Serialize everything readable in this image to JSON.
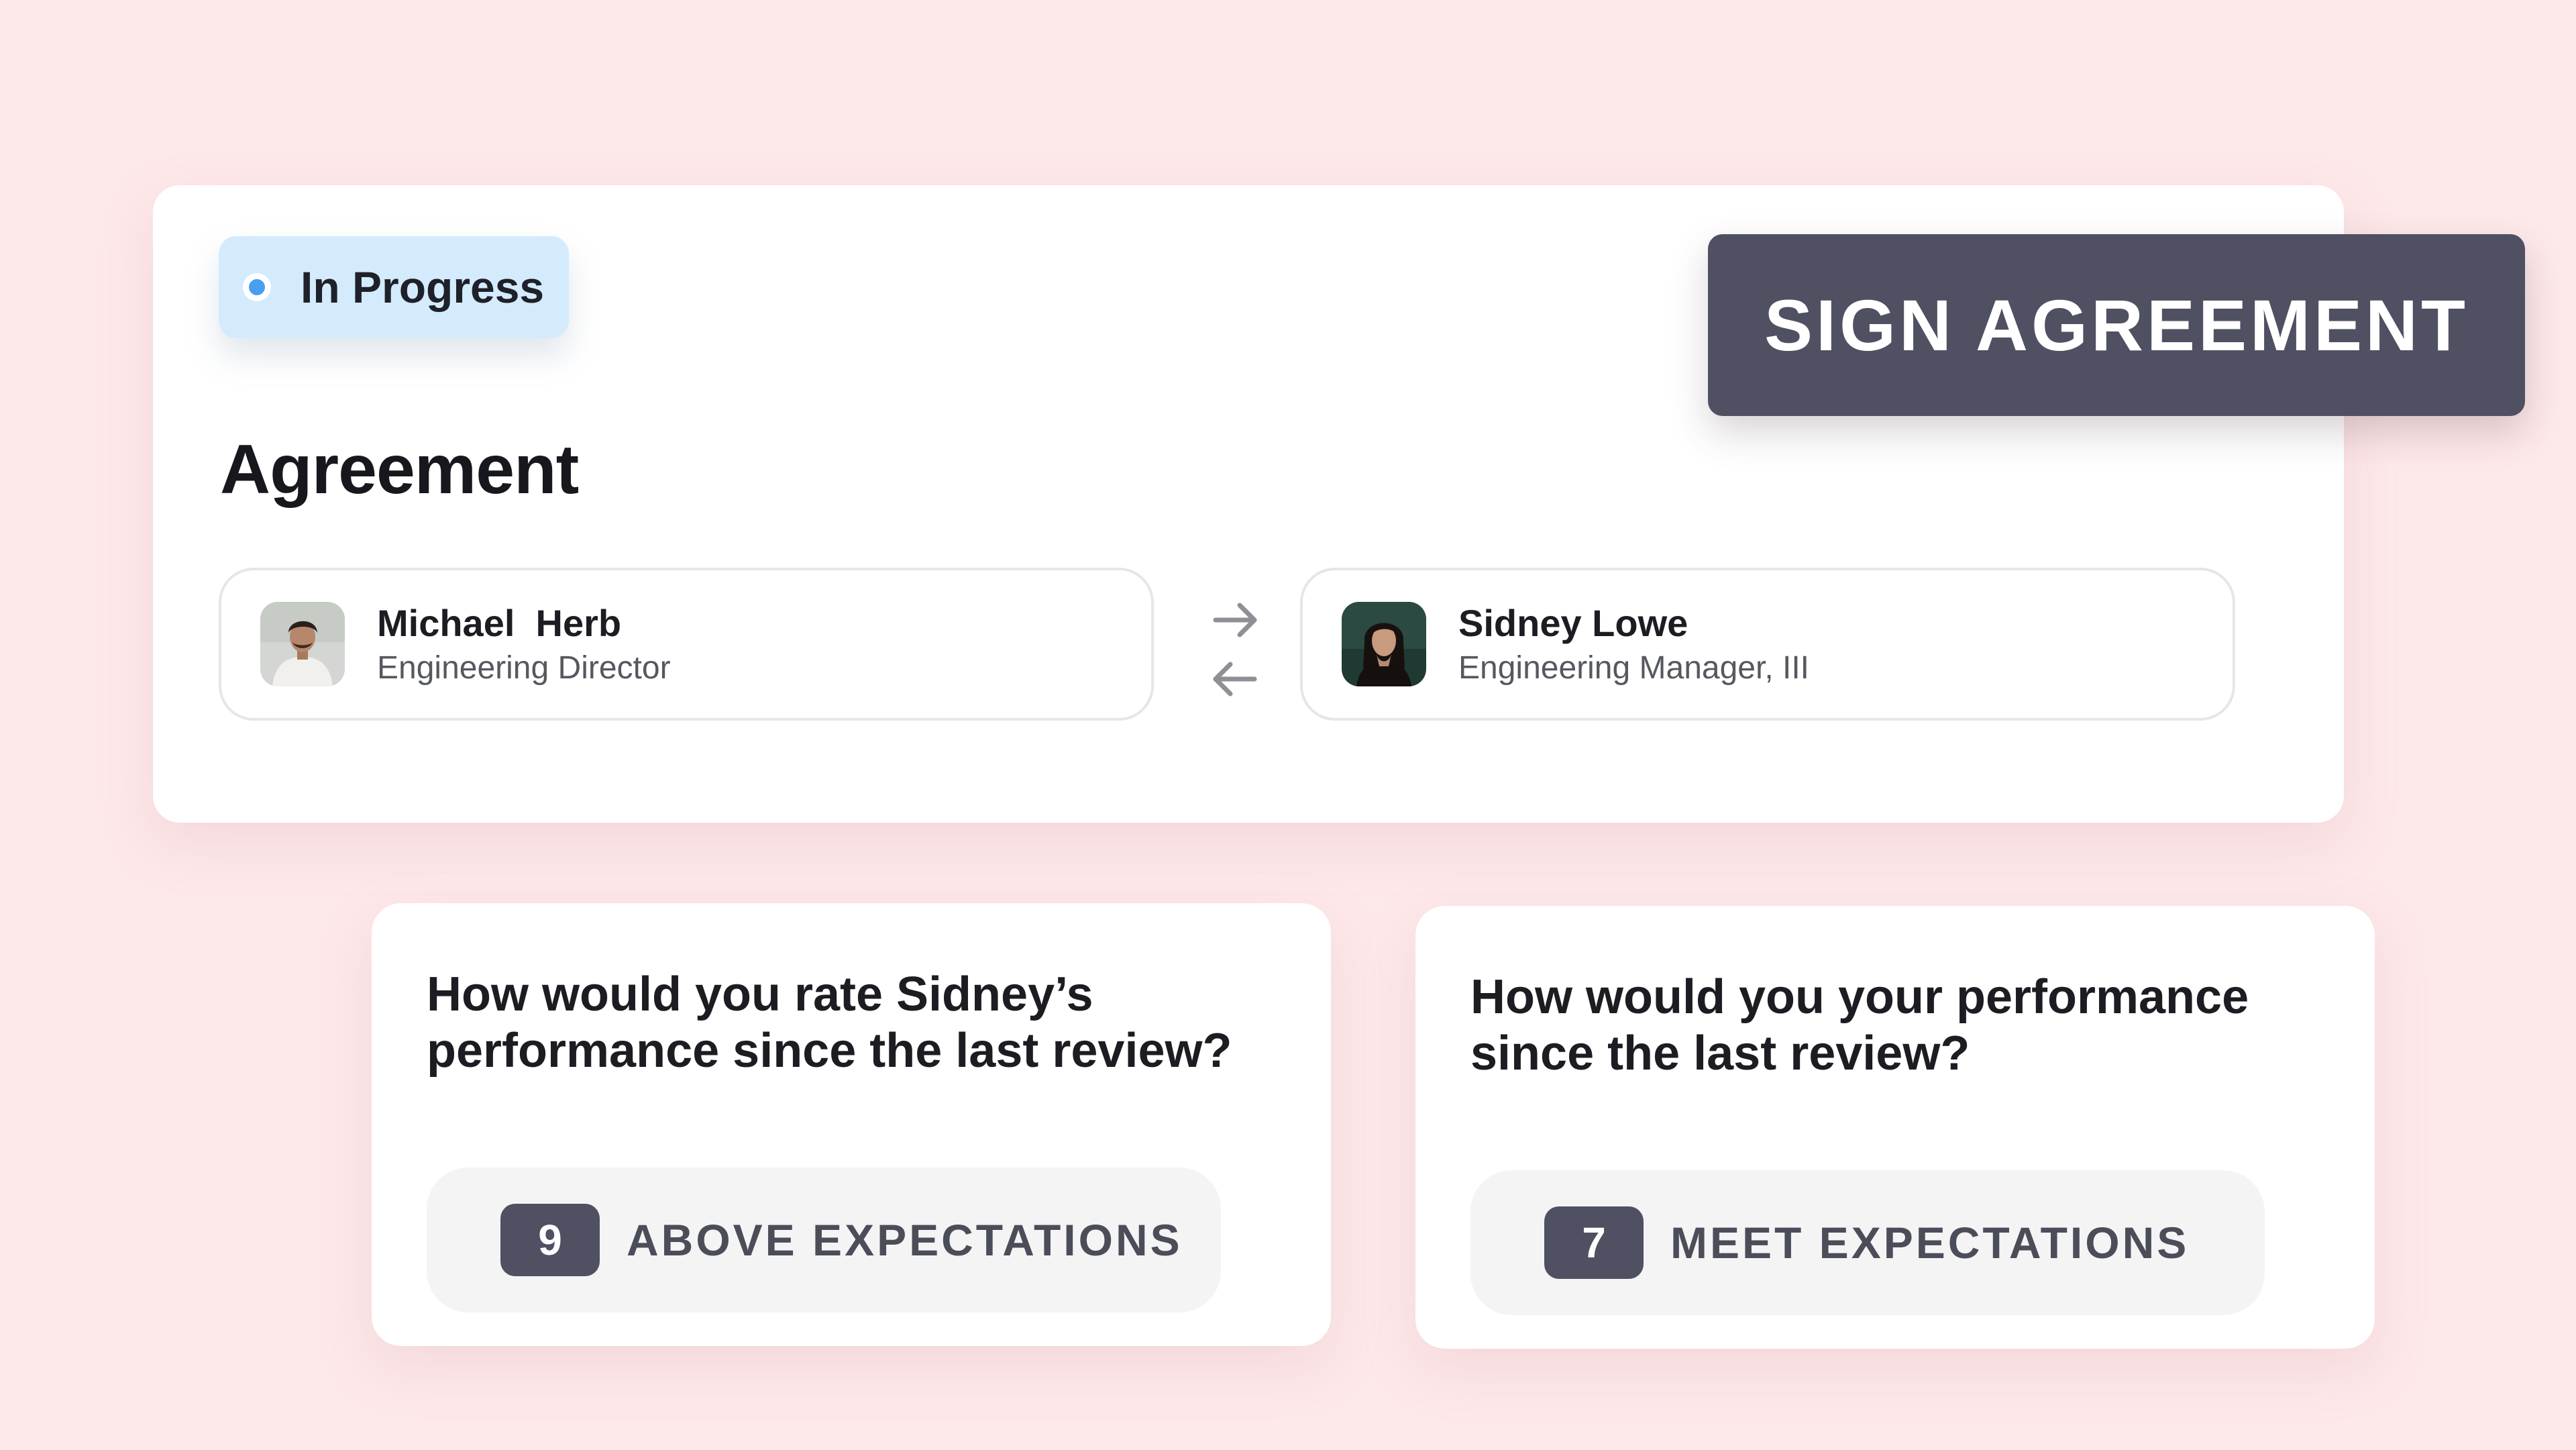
{
  "status": {
    "label": "In Progress",
    "dot_color": "#4a9eef",
    "pill_color": "#d4ebfd"
  },
  "agreement": {
    "title": "Agreement",
    "sign_button_label": "SIGN AGREEMENT",
    "parties": [
      {
        "name": "Michael  Herb",
        "role": "Engineering Director",
        "avatar": "person-photo-icon"
      },
      {
        "name": "Sidney Lowe",
        "role": "Engineering Manager, III",
        "avatar": "person-photo-icon"
      }
    ],
    "swap_icon": "swap-arrows-icon"
  },
  "questions": [
    {
      "text": "How would you rate Sidney’s performance since the last review?",
      "score": "9",
      "rating": "ABOVE EXPECTATIONS"
    },
    {
      "text": "How would you your performance since the last review?",
      "score": "7",
      "rating": "MEET EXPECTATIONS"
    }
  ],
  "colors": {
    "background": "#fde8ea",
    "button": "#4f5062",
    "card": "#ffffff"
  }
}
